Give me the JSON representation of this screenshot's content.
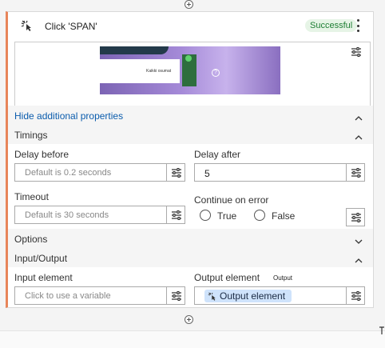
{
  "step": {
    "title": "Click 'SPAN'",
    "status": "Successful",
    "icon": "click-icon"
  },
  "preview": {
    "embedded_text": "Kaikki osumat"
  },
  "links": {
    "hide_additional": "Hide additional properties"
  },
  "sections": {
    "timings": "Timings",
    "options": "Options",
    "input_output": "Input/Output"
  },
  "timings": {
    "delay_before_label": "Delay before",
    "delay_before_placeholder": "Default is 0.2 seconds",
    "delay_after_label": "Delay after",
    "delay_after_value": "5",
    "timeout_label": "Timeout",
    "timeout_placeholder": "Default is 30 seconds",
    "continue_label": "Continue on error",
    "true_label": "True",
    "false_label": "False"
  },
  "io": {
    "input_label": "Input element",
    "input_placeholder": "Click to use a variable",
    "output_label": "Output element",
    "output_tag": "Output",
    "output_chip": "Output element"
  },
  "colors": {
    "accent": "#e8855a",
    "link": "#0b5cad",
    "success_bg": "#e6f4e6",
    "success_text": "#1e7e34",
    "chip_bg": "#cfe3fb"
  }
}
